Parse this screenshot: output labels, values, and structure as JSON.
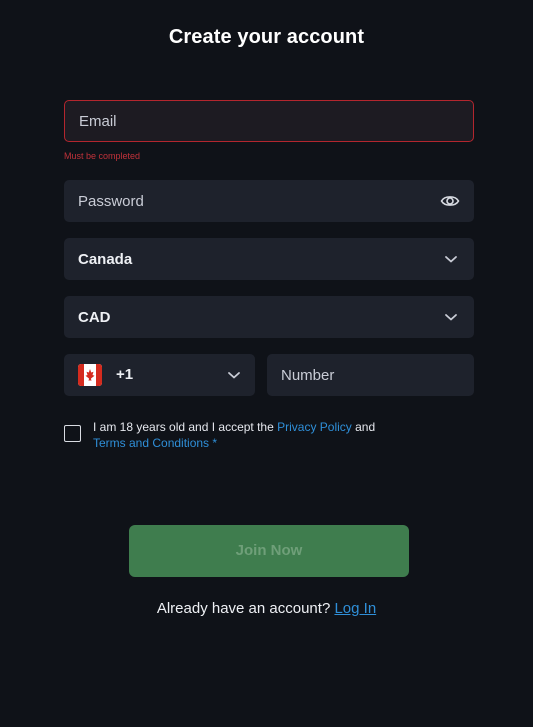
{
  "title": "Create your account",
  "email": {
    "placeholder": "Email",
    "value": "",
    "error": "Must be completed"
  },
  "password": {
    "placeholder": "Password",
    "value": "",
    "icon": "eye-icon"
  },
  "country": {
    "selected": "Canada",
    "icon": "chevron-down-icon"
  },
  "currency": {
    "selected": "CAD",
    "icon": "chevron-down-icon"
  },
  "phone": {
    "flag": "canada-flag-icon",
    "code": "+1",
    "number_placeholder": "Number",
    "number_value": ""
  },
  "terms": {
    "text_before": "I am 18 years old and I accept the ",
    "privacy_link": "Privacy Policy",
    "text_middle": " and ",
    "terms_link": "Terms and Conditions",
    "required_mark": " *"
  },
  "join_button": "Join Now",
  "login": {
    "prompt": "Already have an account? ",
    "link": "Log In"
  },
  "colors": {
    "background": "#0f1218",
    "field": "#1e222c",
    "error": "#b3262e",
    "link": "#2f8fd8",
    "button": "#3f7d4e",
    "flag_red": "#d52b1e"
  }
}
